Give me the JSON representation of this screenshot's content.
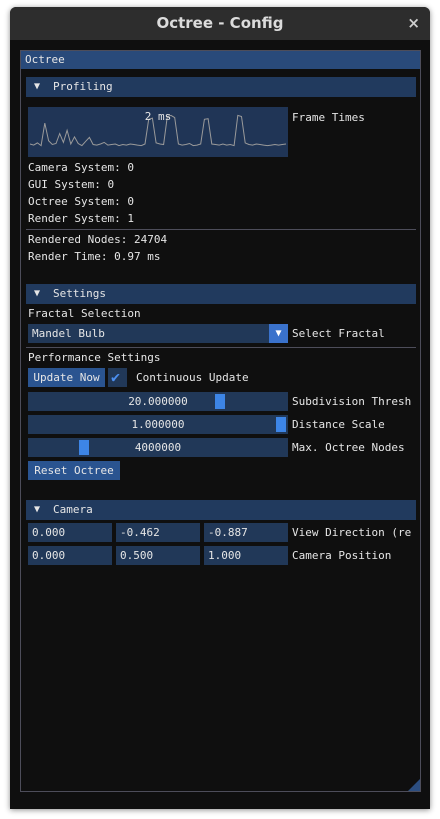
{
  "window": {
    "title": "Octree - Config",
    "close_glyph": "×"
  },
  "panel": {
    "title": "Octree"
  },
  "profiling": {
    "header": "Profiling",
    "arrow": "▼",
    "plot_overlay": "2 ms",
    "plot_label": "Frame Times",
    "frame_times": [
      2.0,
      1.8,
      2.2,
      1.7,
      5.8,
      2.6,
      1.9,
      2.1,
      3.9,
      2.3,
      4.5,
      2.0,
      3.3,
      2.1,
      1.7,
      2.5,
      3.2,
      1.9,
      1.8,
      2.0,
      2.3,
      1.8,
      1.9,
      2.0,
      1.7,
      1.9,
      1.8,
      2.0,
      1.9,
      1.8,
      1.7,
      2.0,
      6.5,
      6.7,
      2.2,
      2.0,
      1.9,
      7.0,
      7.2,
      6.8,
      2.0,
      1.8,
      1.9,
      2.1,
      1.7,
      1.8,
      2.0,
      6.5,
      6.6,
      2.0,
      1.9,
      1.8,
      2.0,
      1.8,
      1.9,
      1.7,
      7.2,
      7.0,
      2.2,
      1.9,
      1.8,
      2.0,
      1.9,
      1.8,
      1.7,
      1.8,
      1.9,
      1.8,
      1.9,
      2.0
    ],
    "stats": [
      "Camera System: 0",
      "GUI System: 0",
      "Octree System: 0",
      "Render System: 1"
    ],
    "rendered_nodes": "Rendered Nodes: 24704",
    "render_time": "Render Time: 0.97 ms"
  },
  "settings": {
    "header": "Settings",
    "arrow": "▼",
    "fractal_selection_label": "Fractal Selection",
    "fractal_value": "Mandel Bulb",
    "fractal_combo_arrow": "▼",
    "select_fractal_label": "Select Fractal",
    "performance_label": "Performance Settings",
    "update_now": "Update Now",
    "continuous_update": "Continuous Update",
    "continuous_checked": true,
    "sliders": [
      {
        "value": "20.000000",
        "label": "Subdivision Thresh",
        "fraction": 0.75
      },
      {
        "value": "1.000000",
        "label": "Distance Scale",
        "fraction": 1.0
      },
      {
        "value": "4000000",
        "label": "Max. Octree Nodes",
        "fraction": 0.2
      }
    ],
    "reset_octree": "Reset Octree"
  },
  "camera": {
    "header": "Camera",
    "arrow": "▼",
    "view_direction": [
      "0.000",
      "-0.462",
      "-0.887"
    ],
    "view_direction_label": "View Direction (re",
    "camera_position": [
      "0.000",
      "0.500",
      "1.000"
    ],
    "camera_position_label": "Camera Position"
  },
  "colors": {
    "accent": "#3d85e6",
    "frame": "#213858",
    "header": "#213a5e",
    "title": "#294a7a",
    "plot_line": "#9a9a9a"
  }
}
